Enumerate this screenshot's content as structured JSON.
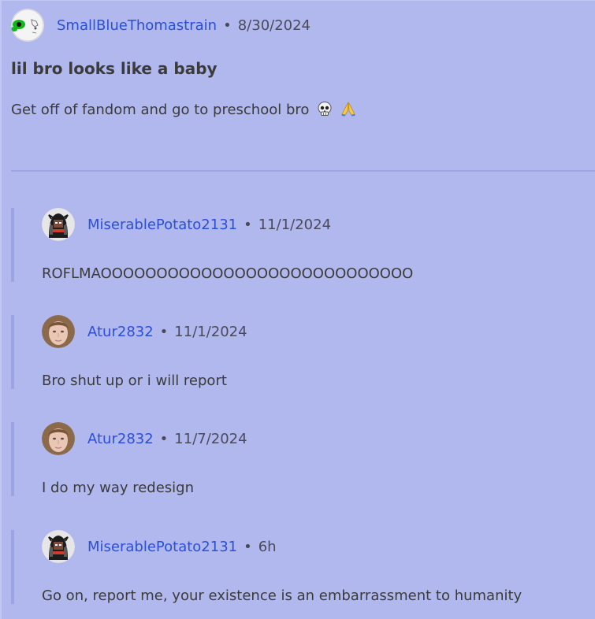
{
  "post": {
    "author": "SmallBlueThomastrain",
    "separator": "•",
    "date": "8/30/2024",
    "title": "lil bro looks like a baby",
    "body": "Get off of fandom and go to preschool bro",
    "emojis": [
      "skull-emoji",
      "folded-hands-emoji"
    ]
  },
  "replies": [
    {
      "author": "MiserablePotato2131",
      "separator": "•",
      "date": "11/1/2024",
      "body": "ROFLMAOOOOOOOOOOOOOOOOOOOOOOOOOOOO",
      "avatar_icon": "masked-figure-avatar"
    },
    {
      "author": "Atur2832",
      "separator": "•",
      "date": "11/1/2024",
      "body": "Bro shut up or i will report",
      "avatar_icon": "face-photo-avatar"
    },
    {
      "author": "Atur2832",
      "separator": "•",
      "date": "11/7/2024",
      "body": "I do my way redesign",
      "avatar_icon": "face-photo-avatar"
    },
    {
      "author": "MiserablePotato2131",
      "separator": "•",
      "date": "6h",
      "body": "Go on, report me, your existence is an embarrassment to humanity",
      "avatar_icon": "masked-figure-avatar"
    }
  ],
  "colors": {
    "background": "#b0b8ee",
    "link": "#2b4fd6",
    "text": "#3b3b3b",
    "thread_line": "#9ca5e2"
  }
}
